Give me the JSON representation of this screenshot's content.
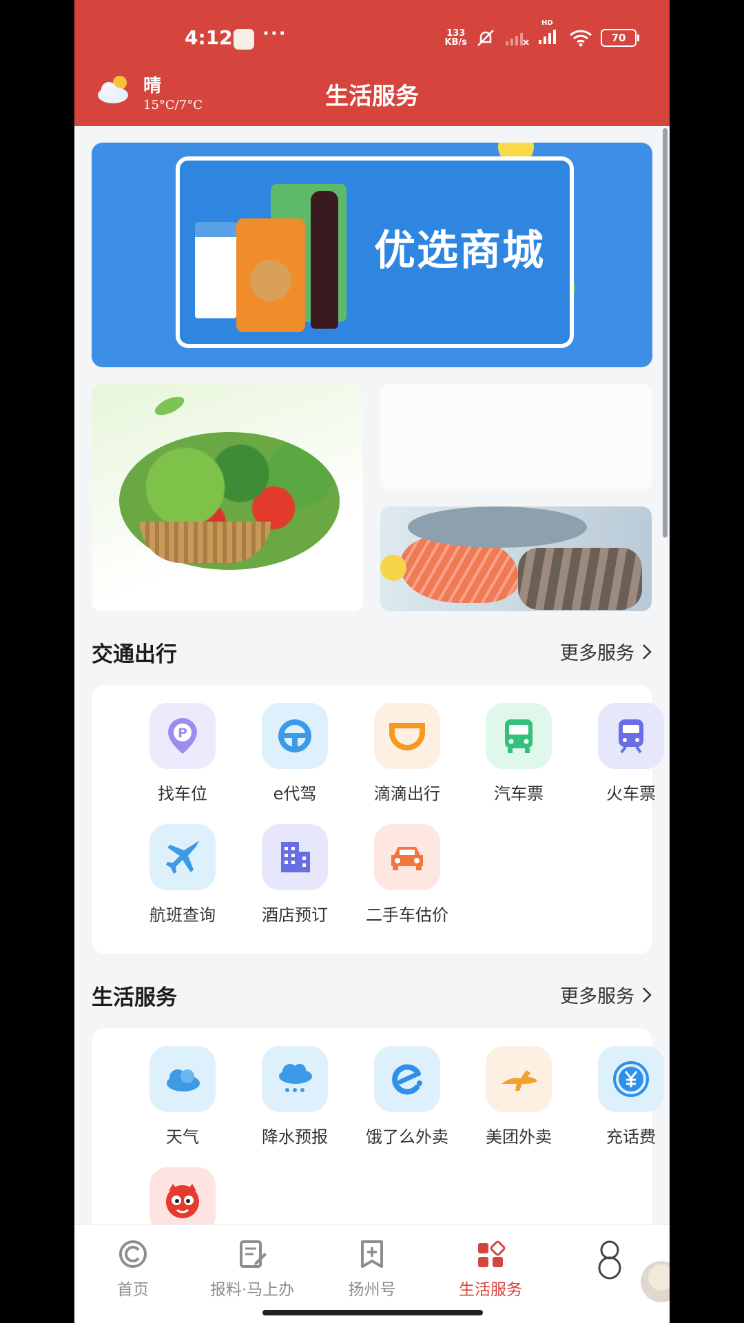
{
  "status_bar": {
    "time": "4:12",
    "dots": "···",
    "net_speed_value": "133",
    "net_speed_unit": "KB/s",
    "hd": "HD",
    "battery": "70"
  },
  "header": {
    "weather_condition": "晴",
    "weather_temp": "15°C/7°C",
    "title": "生活服务"
  },
  "banner": {
    "text": "优选商城"
  },
  "sections": {
    "transport": {
      "title": "交通出行",
      "more": "更多服务",
      "items": [
        {
          "label": "找车位",
          "icon": "parking-pin-icon"
        },
        {
          "label": "e代驾",
          "icon": "steering-wheel-icon"
        },
        {
          "label": "滴滴出行",
          "icon": "didi-logo-icon"
        },
        {
          "label": "汽车票",
          "icon": "bus-icon"
        },
        {
          "label": "火车票",
          "icon": "train-icon"
        },
        {
          "label": "航班查询",
          "icon": "airplane-icon"
        },
        {
          "label": "酒店预订",
          "icon": "hotel-building-icon"
        },
        {
          "label": "二手车估价",
          "icon": "car-icon"
        }
      ]
    },
    "life": {
      "title": "生活服务",
      "more": "更多服务",
      "items": [
        {
          "label": "天气",
          "icon": "cloud-icon"
        },
        {
          "label": "降水预报",
          "icon": "rain-cloud-icon"
        },
        {
          "label": "饿了么外卖",
          "icon": "eleme-logo-icon"
        },
        {
          "label": "美团外卖",
          "icon": "meituan-kangaroo-icon"
        },
        {
          "label": "充话费",
          "icon": "yuan-coin-icon"
        },
        {
          "label": "",
          "icon": "tmall-cat-icon"
        }
      ]
    }
  },
  "bottom_nav": [
    {
      "label": "首页",
      "icon": "home-icon",
      "active": false
    },
    {
      "label": "报料·马上办",
      "icon": "report-edit-icon",
      "active": false
    },
    {
      "label": "扬州号",
      "icon": "bookmark-plus-icon",
      "active": false
    },
    {
      "label": "生活服务",
      "icon": "grid-apps-icon",
      "active": true
    },
    {
      "label": "",
      "icon": "snowman-icon",
      "active": false
    }
  ],
  "colors": {
    "brand_red": "#d6443e",
    "banner_blue": "#3d8fe6",
    "page_bg": "#f4f5f7",
    "inactive_gray": "#8d8d8d"
  }
}
